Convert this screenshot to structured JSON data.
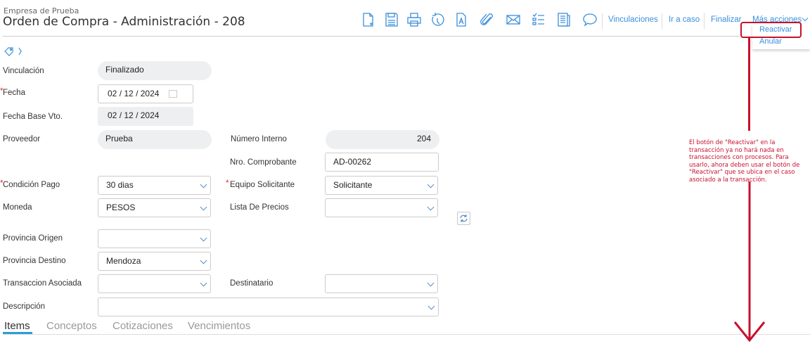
{
  "header": {
    "company": "Empresa de Prueba",
    "title": "Orden de Compra - Administración - 208"
  },
  "toolbar": {
    "icons": [
      "new-document-icon",
      "save-icon",
      "print-icon",
      "history-icon",
      "pdf-icon",
      "attachment-icon",
      "email-icon",
      "checklist-icon",
      "report-icon",
      "comment-icon"
    ],
    "links": [
      "Vinculaciones",
      "Ir a caso",
      "Finalizar",
      "Más acciones"
    ]
  },
  "menu": {
    "items": [
      "Reactivar",
      "Anular"
    ]
  },
  "fields": {
    "vinculacion": {
      "label": "Vinculación",
      "value": "Finalizado"
    },
    "fecha": {
      "label": "Fecha",
      "day": "02",
      "month": "12",
      "year": "2024"
    },
    "fecha_base": {
      "label": "Fecha Base Vto.",
      "day": "02",
      "month": "12",
      "year": "2024"
    },
    "proveedor": {
      "label": "Proveedor",
      "value": "Prueba"
    },
    "numero_interno": {
      "label": "Número Interno",
      "value": "204"
    },
    "nro_comprobante": {
      "label": "Nro. Comprobante",
      "value": "AD-00262"
    },
    "condicion_pago": {
      "label": "Condición Pago",
      "value": "30 dias"
    },
    "equipo_solicitante": {
      "label": "Equipo Solicitante",
      "value": "Solicitante"
    },
    "moneda": {
      "label": "Moneda",
      "value": "PESOS"
    },
    "lista_precios": {
      "label": "Lista De Precios",
      "value": ""
    },
    "provincia_origen": {
      "label": "Provincia Origen",
      "value": ""
    },
    "provincia_destino": {
      "label": "Provincia Destino",
      "value": "Mendoza"
    },
    "transaccion": {
      "label": "Transaccion Asociada",
      "value": ""
    },
    "destinatario": {
      "label": "Destinatario",
      "value": ""
    },
    "descripcion": {
      "label": "Descripción",
      "value": ""
    }
  },
  "tabs": [
    "Items",
    "Conceptos",
    "Cotizaciones",
    "Vencimientos"
  ],
  "annotation": {
    "text": "El botón de \"Reactivar\" en la transacción ya no hará nada en transacciones con procesos. Para usarlo, ahora deben usar el botón de \"Reactivar\" que se ubica en el caso asociado a la transacción.",
    "color": "#c8102e"
  }
}
